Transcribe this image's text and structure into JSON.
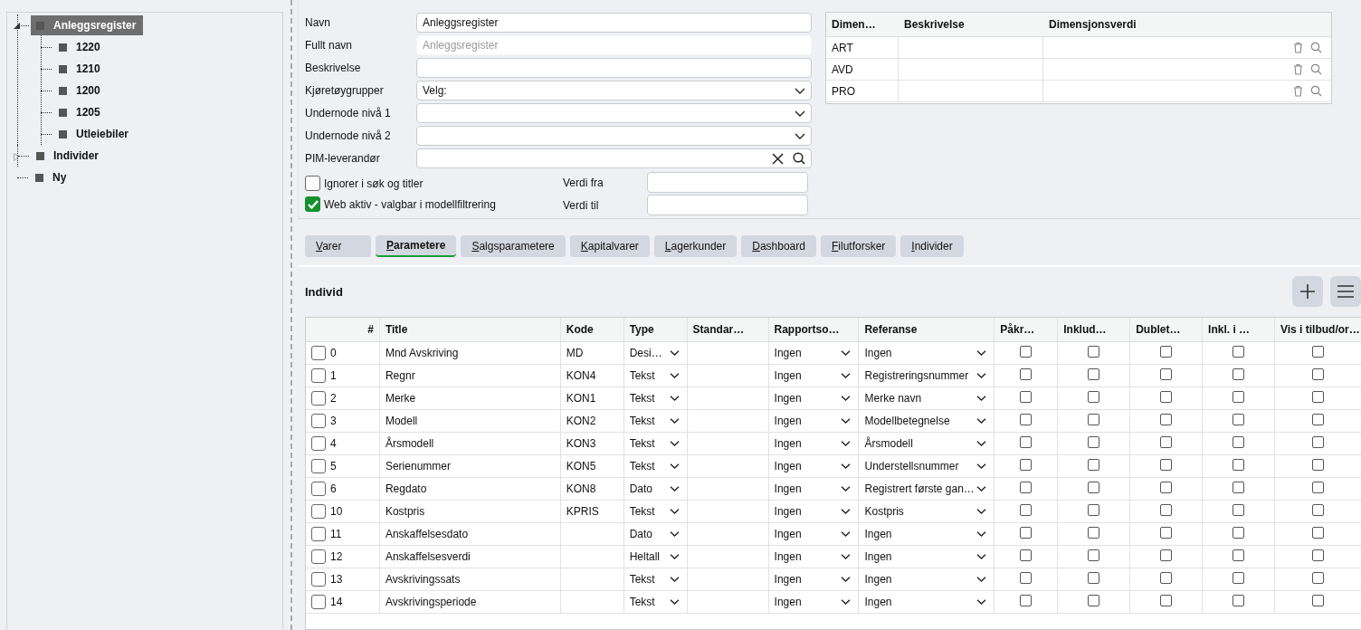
{
  "tree": [
    {
      "label": "Anleggsregister",
      "expanded": true,
      "selected": true,
      "children": [
        {
          "label": "1220",
          "selected": false
        },
        {
          "label": "1210",
          "selected": false
        },
        {
          "label": "1200",
          "selected": false
        },
        {
          "label": "1205",
          "selected": false
        },
        {
          "label": "Utleiebiler",
          "selected": false
        }
      ]
    },
    {
      "label": "Individer",
      "expanded": false,
      "selected": false
    },
    {
      "label": "Ny",
      "selected": false
    }
  ],
  "form": {
    "fields": [
      {
        "label": "Navn",
        "kind": "text",
        "value": "Anleggsregister"
      },
      {
        "label": "Fullt navn",
        "kind": "readonly",
        "placeholder": "Anleggsregister"
      },
      {
        "label": "Beskrivelse",
        "kind": "text"
      },
      {
        "label": "Kjøretøygrupper",
        "kind": "select",
        "value": "Velg:"
      },
      {
        "label": "Undernode nivå 1",
        "kind": "select"
      },
      {
        "label": "Undernode nivå 2",
        "kind": "select"
      },
      {
        "label": "PIM-leverandør",
        "kind": "lookup"
      }
    ],
    "options": [
      {
        "label": "Ignorer i søk og titler",
        "checked": false
      },
      {
        "label": "Web aktiv - valgbar i modellfiltrering",
        "checked": true
      }
    ],
    "range": [
      {
        "label": "Verdi fra"
      },
      {
        "label": "Verdi til"
      }
    ]
  },
  "dimensions": {
    "columns": [
      "Dimen…",
      "Beskrivelse",
      "Dimensjonsverdi"
    ],
    "rows": [
      {
        "code": "ART"
      },
      {
        "code": "AVD"
      },
      {
        "code": "PRO"
      }
    ]
  },
  "tabs": [
    {
      "label": "Varer",
      "selected": false
    },
    {
      "label": "Parametere",
      "selected": true
    },
    {
      "label": "Salgsparametere",
      "selected": false
    },
    {
      "label": "Kapitalvarer",
      "selected": false
    },
    {
      "label": "Lagerkunder",
      "selected": false
    },
    {
      "label": "Dashboard",
      "selected": false
    },
    {
      "label": "Filutforsker",
      "selected": false
    },
    {
      "label": "Individer",
      "selected": false
    }
  ],
  "section": {
    "title": "Individ"
  },
  "table": {
    "columns": [
      "#",
      "Title",
      "Kode",
      "Type",
      "Standar…",
      "Rapportso…",
      "Referanse",
      "Påkr…",
      "Inklud…",
      "Dublet…",
      "Inkl. i …",
      "Vis i tilbud/or…"
    ],
    "rows": [
      {
        "checked": false,
        "num": "0",
        "title": "Mnd Avskriving",
        "kode": "MD",
        "type": "Desi…",
        "rapport": "Ingen",
        "referanse": "Ingen",
        "flags": [
          false,
          false,
          false,
          false,
          false
        ]
      },
      {
        "checked": false,
        "num": "1",
        "title": "Regnr",
        "kode": "KON4",
        "type": "Tekst",
        "rapport": "Ingen",
        "referanse": "Registreringsnummer",
        "flags": [
          false,
          false,
          false,
          false,
          false
        ]
      },
      {
        "checked": false,
        "num": "2",
        "title": "Merke",
        "kode": "KON1",
        "type": "Tekst",
        "rapport": "Ingen",
        "referanse": "Merke navn",
        "flags": [
          false,
          false,
          false,
          false,
          false
        ]
      },
      {
        "checked": false,
        "num": "3",
        "title": "Modell",
        "kode": "KON2",
        "type": "Tekst",
        "rapport": "Ingen",
        "referanse": "Modellbetegnelse",
        "flags": [
          false,
          false,
          false,
          false,
          false
        ]
      },
      {
        "checked": false,
        "num": "4",
        "title": "Årsmodell",
        "kode": "KON3",
        "type": "Tekst",
        "rapport": "Ingen",
        "referanse": "Årsmodell",
        "flags": [
          false,
          false,
          false,
          false,
          false
        ]
      },
      {
        "checked": false,
        "num": "5",
        "title": "Serienummer",
        "kode": "KON5",
        "type": "Tekst",
        "rapport": "Ingen",
        "referanse": "Understellsnummer",
        "flags": [
          false,
          false,
          false,
          false,
          false
        ]
      },
      {
        "checked": false,
        "num": "6",
        "title": "Regdato",
        "kode": "KON8",
        "type": "Dato",
        "rapport": "Ingen",
        "referanse": "Registrert første gan…",
        "flags": [
          false,
          false,
          false,
          false,
          false
        ]
      },
      {
        "checked": false,
        "num": "10",
        "title": "Kostpris",
        "kode": "KPRIS",
        "type": "Tekst",
        "rapport": "Ingen",
        "referanse": "Kostpris",
        "flags": [
          false,
          false,
          false,
          false,
          false
        ]
      },
      {
        "checked": false,
        "num": "11",
        "title": "Anskaffelsesdato",
        "type": "Dato",
        "rapport": "Ingen",
        "referanse": "Ingen",
        "flags": [
          false,
          false,
          false,
          false,
          false
        ]
      },
      {
        "checked": false,
        "num": "12",
        "title": "Anskaffelsesverdi",
        "type": "Heltall",
        "rapport": "Ingen",
        "referanse": "Ingen",
        "flags": [
          false,
          false,
          false,
          false,
          false
        ]
      },
      {
        "checked": false,
        "num": "13",
        "title": "Avskrivingssats",
        "type": "Tekst",
        "rapport": "Ingen",
        "referanse": "Ingen",
        "flags": [
          false,
          false,
          false,
          false,
          false
        ]
      },
      {
        "checked": false,
        "num": "14",
        "title": "Avskrivingsperiode",
        "type": "Tekst",
        "rapport": "Ingen",
        "referanse": "Ingen",
        "flags": [
          false,
          false,
          false,
          false,
          false
        ]
      }
    ]
  }
}
